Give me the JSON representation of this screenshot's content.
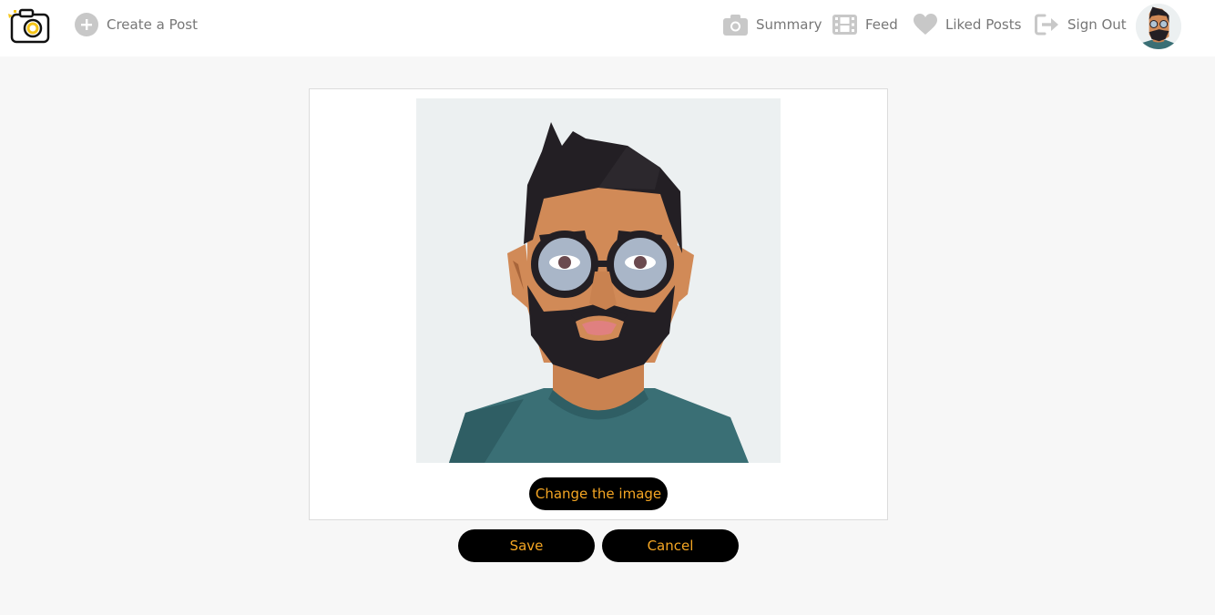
{
  "nav": {
    "create_post": "Create a Post",
    "summary": "Summary",
    "feed": "Feed",
    "liked_posts": "Liked Posts",
    "sign_out": "Sign Out"
  },
  "icons": {
    "logo": "camera-logo-icon",
    "create_post": "plus-circle-icon",
    "summary": "camera-icon",
    "feed": "film-icon",
    "liked_posts": "heart-icon",
    "sign_out": "sign-out-icon"
  },
  "editor": {
    "change_image_label": "Change the image",
    "save_label": "Save",
    "cancel_label": "Cancel"
  },
  "colors": {
    "accent": "#f5a623",
    "button_bg": "#000000",
    "page_bg": "#f7f7f7",
    "nav_icon": "#c8c8c8",
    "nav_text": "#777777",
    "shirt": "#3a6f75",
    "skin": "#d18a57",
    "hair": "#231f24"
  }
}
